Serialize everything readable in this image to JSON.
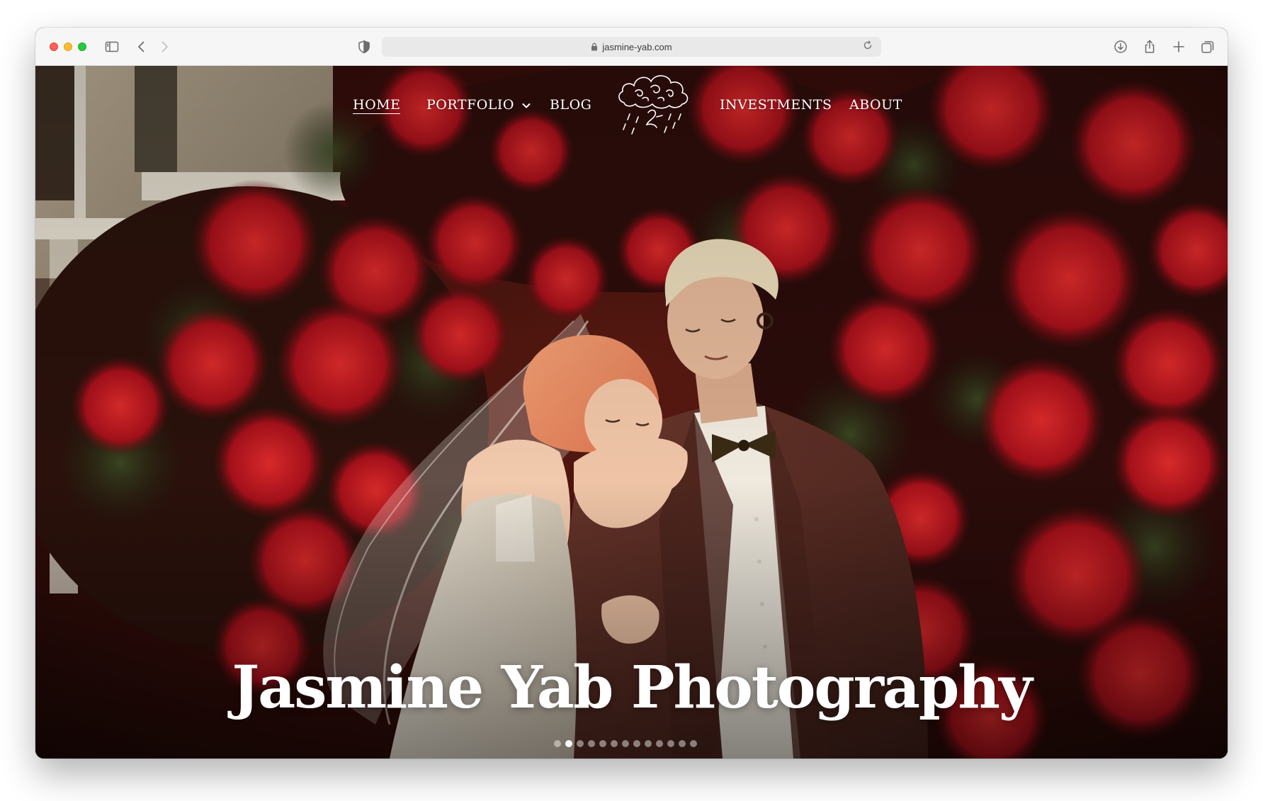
{
  "browser": {
    "url": "jasmine-yab.com"
  },
  "nav": {
    "items": [
      {
        "label": "HOME"
      },
      {
        "label": "PORTFOLIO"
      },
      {
        "label": "BLOG"
      },
      {
        "label": "INVESTMENTS"
      },
      {
        "label": "ABOUT"
      }
    ],
    "active": "HOME"
  },
  "hero": {
    "title": "Jasmine Yab Photography",
    "slides_total": 13,
    "active_slide": 2
  },
  "icons": {
    "sidebar": "sidebar-icon",
    "back": "chevron-left-icon",
    "forward": "chevron-right-icon",
    "privacy": "shield-icon",
    "lock": "lock-icon",
    "reload": "reload-icon",
    "download": "download-icon",
    "share": "share-icon",
    "new_tab": "plus-icon",
    "tabs": "tabs-overview-icon",
    "logo": "cloud-rain-logo-icon"
  },
  "colors": {
    "toolbar_bg": "#f6f6f6",
    "address_bg": "#e9e9e9",
    "nav_text": "#ffffff",
    "flower_red": "#b4121c",
    "suit_brown": "#5a2d25"
  }
}
